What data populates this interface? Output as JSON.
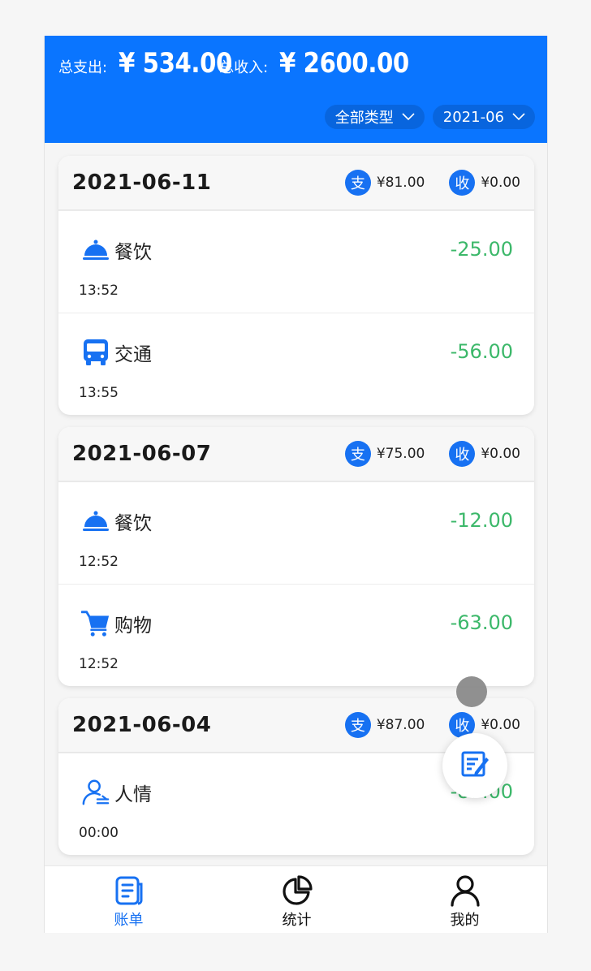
{
  "header": {
    "spend_label": "总支出:",
    "spend_amount": "¥ 534.00",
    "income_label": "总收入:",
    "income_amount": "¥ 2600.00",
    "type_filter": "全部类型",
    "month_filter": "2021-06"
  },
  "badges": {
    "spend": "支",
    "income": "收"
  },
  "days": [
    {
      "date": "2021-06-11",
      "spend": "¥81.00",
      "income": "¥0.00",
      "items": [
        {
          "icon": "dining-icon",
          "category": "餐饮",
          "amount": "-25.00",
          "time": "13:52"
        },
        {
          "icon": "bus-icon",
          "category": "交通",
          "amount": "-56.00",
          "time": "13:55"
        }
      ]
    },
    {
      "date": "2021-06-07",
      "spend": "¥75.00",
      "income": "¥0.00",
      "items": [
        {
          "icon": "dining-icon",
          "category": "餐饮",
          "amount": "-12.00",
          "time": "12:52"
        },
        {
          "icon": "cart-icon",
          "category": "购物",
          "amount": "-63.00",
          "time": "12:52"
        }
      ]
    },
    {
      "date": "2021-06-04",
      "spend": "¥87.00",
      "income": "¥0.00",
      "items": [
        {
          "icon": "social-icon",
          "category": "人情",
          "amount": "-87.00",
          "time": "00:00"
        }
      ]
    }
  ],
  "tabs": [
    {
      "label": "账单",
      "icon": "bill-icon",
      "active": true
    },
    {
      "label": "统计",
      "icon": "pie-chart-icon",
      "active": false
    },
    {
      "label": "我的",
      "icon": "user-icon",
      "active": false
    }
  ],
  "colors": {
    "primary": "#0a75ff",
    "expense": "#3cb86a",
    "badge": "#1771f2"
  }
}
